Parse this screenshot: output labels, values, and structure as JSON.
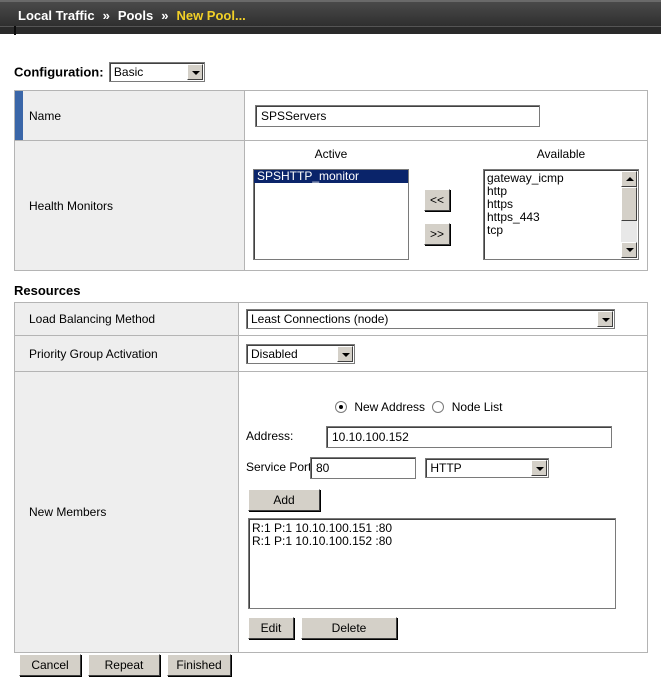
{
  "breadcrumb": {
    "items": [
      "Local Traffic",
      "Pools"
    ],
    "separator": "»",
    "current": "New Pool..."
  },
  "configuration": {
    "label": "Configuration:",
    "value": "Basic"
  },
  "name": {
    "label": "Name",
    "value": "SPSServers"
  },
  "health_monitors": {
    "label": "Health Monitors",
    "active_header": "Active",
    "available_header": "Available",
    "active": [
      "SPSHTTP_monitor"
    ],
    "available": [
      "gateway_icmp",
      "http",
      "https",
      "https_443",
      "tcp"
    ],
    "move_left_label": "<<",
    "move_right_label": ">>"
  },
  "resources": {
    "header": "Resources"
  },
  "load_balancing": {
    "label": "Load Balancing Method",
    "value": "Least Connections (node)"
  },
  "priority_group": {
    "label": "Priority Group Activation",
    "value": "Disabled"
  },
  "new_members": {
    "label": "New Members",
    "radio_new_address": "New Address",
    "radio_node_list": "Node List",
    "address_label": "Address:",
    "address_value": "10.10.100.152",
    "service_port_label": "Service Port:",
    "service_port_value": "80",
    "service_value": "HTTP",
    "add_label": "Add",
    "members": [
      "R:1 P:1 10.10.100.151 :80",
      "R:1 P:1 10.10.100.152 :80"
    ],
    "edit_label": "Edit",
    "delete_label": "Delete"
  },
  "footer": {
    "cancel_label": "Cancel",
    "repeat_label": "Repeat",
    "finished_label": "Finished"
  },
  "colors": {
    "title_bar": "#333333",
    "current_crumb": "#f2d028",
    "label_cell": "#eeeeee",
    "selection": "#0a246a",
    "name_marker": "#3a66a8"
  }
}
